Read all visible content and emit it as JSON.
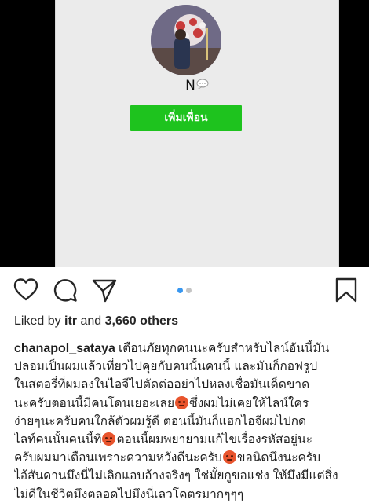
{
  "media": {
    "profile_name": "N",
    "add_friend_label": "เพิ่มเพื่อน",
    "carousel_count": 2,
    "carousel_active": 1
  },
  "actions": {
    "icons": [
      "heart-icon",
      "comment-icon",
      "share-icon",
      "bookmark-icon"
    ],
    "accent_color": "#3897f0"
  },
  "likes": {
    "prefix": "Liked by",
    "user": "itr",
    "connector": "and",
    "count": "3,660 others"
  },
  "caption": {
    "username": "chanapol_sataya",
    "lines": [
      "เตือนภัยทุกคนนะครับสำหรับไลน์อันนี้มัน",
      "ปลอมเป็นผมแล้วเที่ยวไปคุยกับคนนั้นคนนี้ และมันก็กอฟรูป",
      "ในสตอรี่ที่ผมลงในไอจีไปตัดต่ออย่าไปหลงเชื่อมันเด็ดขาด",
      "นะครับตอนนี้มีคนโดนเยอะเลย",
      "ซึ่งผมไม่เคยให้ไลน์ใคร",
      "ง่ายๆนะครับคนใกล้ตัวผมรู้ดี ตอนนี้มันก็แฮกไอจีผมไปกด",
      "ไลท์คนนั้นคนนี้ที",
      "ตอนนี้ผมพยายามแก้ไขเรื่องรหัสอยู่นะ",
      "ครับผมมาเตือนเพราะความหวังดีนะครับ",
      "ขอนิดนึงนะครับ",
      "ไอ้สันดานมึงนี่ไม่เลิกแอบอ้างจริงๆ ใช่มั้ยกูขอแช่ง ให้มึงมีแต่สิ่ง",
      "ไม่ดีในชีวิตมึงตลอดไปมึงนี่เลวโคตรมากๆๆๆ"
    ]
  }
}
